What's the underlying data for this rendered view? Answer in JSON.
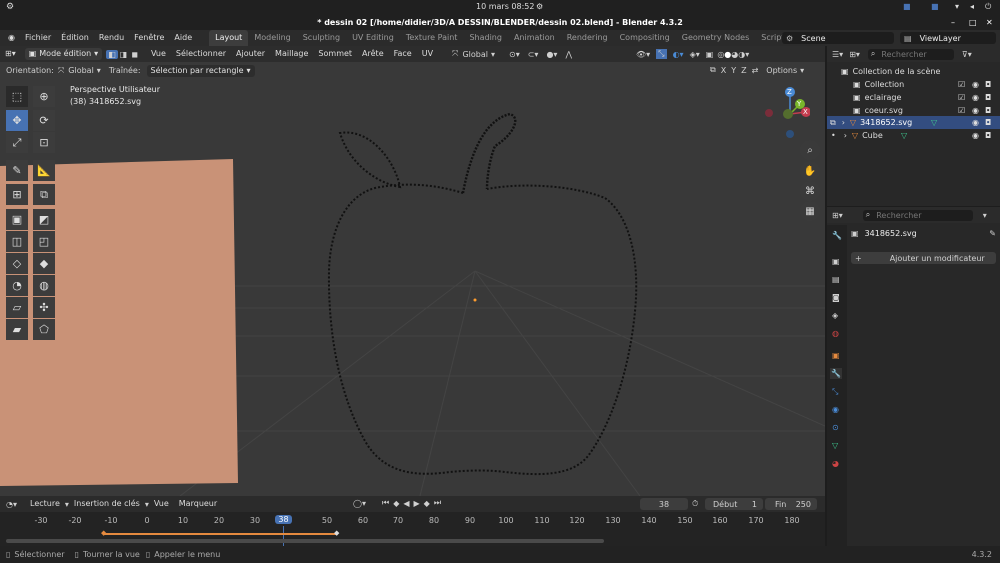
{
  "system_bar": {
    "datetime": "10 mars  08:52"
  },
  "window": {
    "title": "* dessin 02 [/home/didier/3D/A DESSIN/BLENDER/dessin 02.blend] - Blender 4.3.2"
  },
  "menu": [
    "Fichier",
    "Édition",
    "Rendu",
    "Fenêtre",
    "Aide"
  ],
  "workspaces": [
    "Layout",
    "Modeling",
    "Sculpting",
    "UV Editing",
    "Texture Paint",
    "Shading",
    "Animation",
    "Rendering",
    "Compositing",
    "Geometry Nodes",
    "Scripting"
  ],
  "active_workspace": "Layout",
  "scene": {
    "name": "Scene",
    "view_layer": "ViewLayer"
  },
  "viewport_header": {
    "mode": "Mode édition",
    "menus": [
      "Vue",
      "Sélectionner",
      "Ajouter",
      "Maillage",
      "Sommet",
      "Arête",
      "Face",
      "UV"
    ],
    "transform_orientation": "Global"
  },
  "tool_header": {
    "orientation_label": "Orientation:",
    "orientation_value": "Global",
    "drag_label": "Traînée:",
    "drag_value": "Sélection par rectangle",
    "axes": [
      "X",
      "Y",
      "Z"
    ],
    "options_label": "Options"
  },
  "viewport": {
    "perspective": "Perspective Utilisateur",
    "object_info": "(38) 3418652.svg"
  },
  "gizmo": {
    "x": "X",
    "y": "Y",
    "z": "Z"
  },
  "outliner": {
    "search_placeholder": "Rechercher",
    "items": [
      {
        "label": "Collection de la scène"
      },
      {
        "label": "Collection"
      },
      {
        "label": "eclairage"
      },
      {
        "label": "coeur.svg"
      },
      {
        "label": "3418652.svg"
      },
      {
        "label": "Cube"
      }
    ]
  },
  "properties": {
    "search_placeholder": "Rechercher",
    "object_name": "3418652.svg",
    "add_modifier": "Ajouter un modificateur"
  },
  "timeline": {
    "menus": [
      "Lecture",
      "Insertion de clés",
      "Vue",
      "Marqueur"
    ],
    "current_frame": "38",
    "start_label": "Début",
    "start_value": "1",
    "end_label": "Fin",
    "end_value": "250",
    "ticks": [
      "-30",
      "-20",
      "-10",
      "0",
      "10",
      "20",
      "30",
      "38",
      "50",
      "60",
      "70",
      "80",
      "90",
      "100",
      "110",
      "120",
      "130",
      "140",
      "150",
      "160",
      "170",
      "180"
    ]
  },
  "status_bar": {
    "select": "Sélectionner",
    "rotate": "Tourner la vue",
    "menu": "Appeler le menu",
    "version": "4.3.2"
  },
  "colors": {
    "accent": "#4772b3",
    "plane": "#c99277",
    "curve": "#111111"
  }
}
